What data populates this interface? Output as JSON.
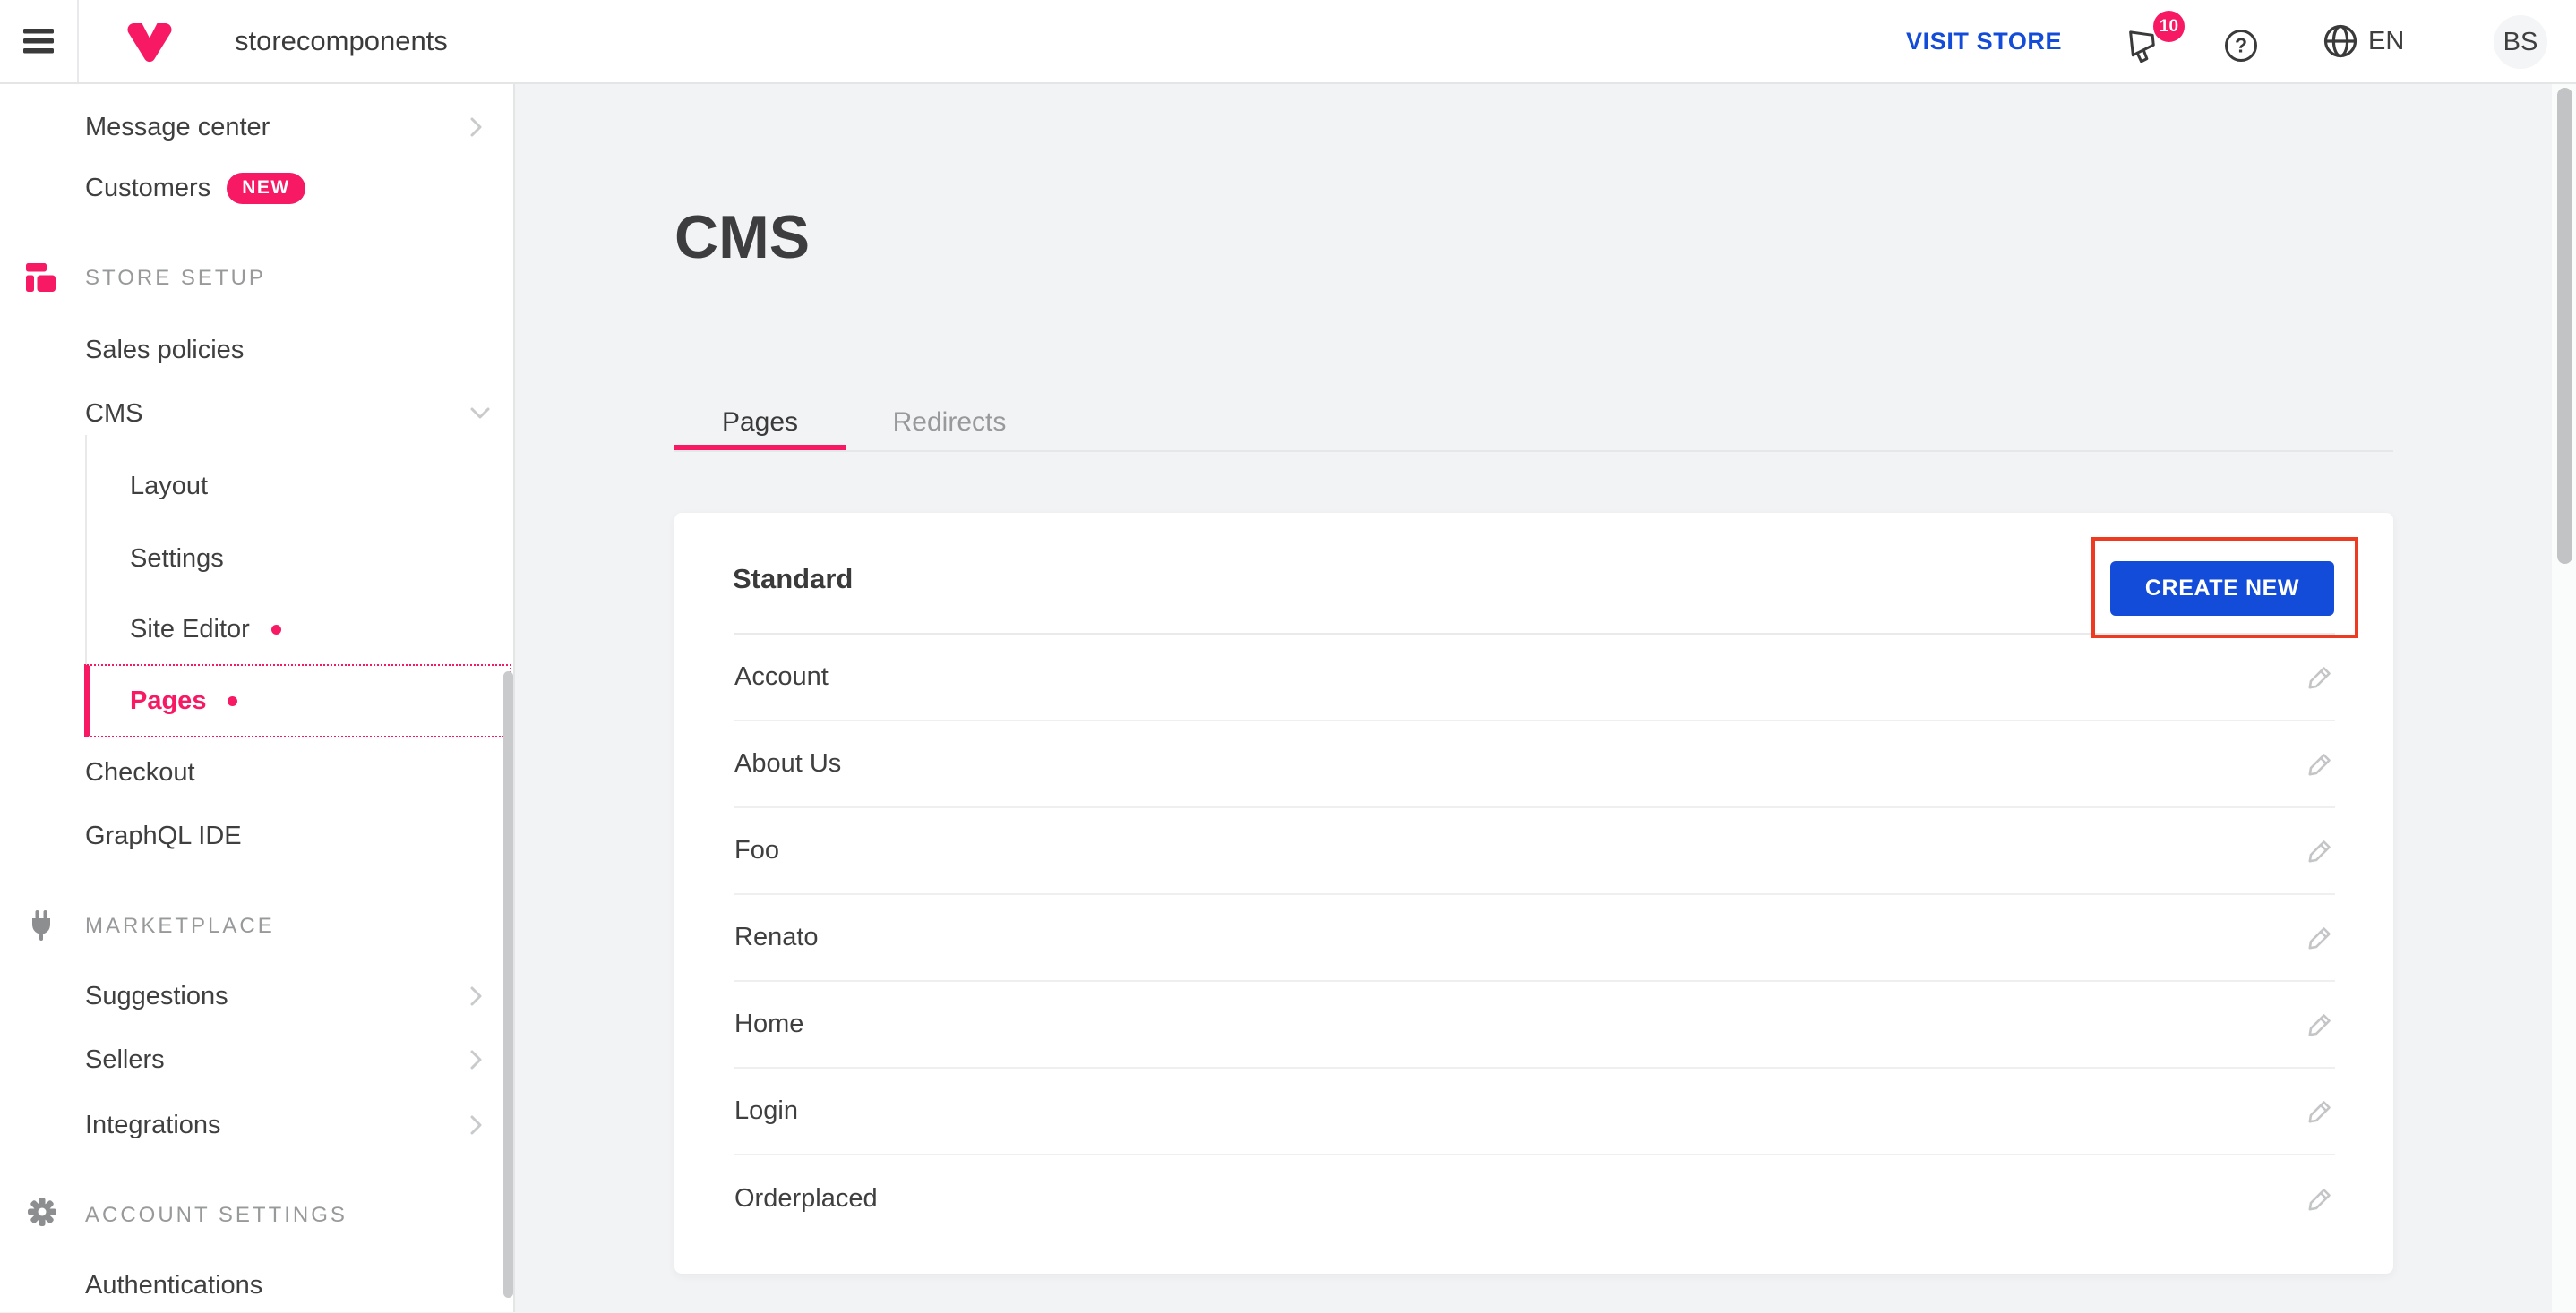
{
  "topbar": {
    "store_name": "storecomponents",
    "visit_store": "VISIT STORE",
    "notification_count": "10",
    "language": "EN",
    "user_initials": "BS"
  },
  "sidebar": {
    "message_center": "Message center",
    "customers": "Customers",
    "customers_badge": "NEW",
    "store_setup": "STORE SETUP",
    "sales_policies": "Sales policies",
    "cms": "CMS",
    "layout": "Layout",
    "settings": "Settings",
    "site_editor": "Site Editor",
    "pages": "Pages",
    "checkout": "Checkout",
    "graphql_ide": "GraphQL IDE",
    "marketplace": "MARKETPLACE",
    "suggestions": "Suggestions",
    "sellers": "Sellers",
    "integrations": "Integrations",
    "account_settings": "ACCOUNT SETTINGS",
    "authentications": "Authentications"
  },
  "main": {
    "title": "CMS",
    "tabs": [
      {
        "label": "Pages",
        "active": true
      },
      {
        "label": "Redirects",
        "active": false
      }
    ],
    "card": {
      "title": "Standard",
      "create_button": "CREATE NEW",
      "pages": [
        "Account",
        "About Us",
        "Foo",
        "Renato",
        "Home",
        "Login",
        "Orderplaced"
      ]
    }
  },
  "icons": {
    "hamburger": "menu-icon",
    "logo": "vtex-logo-icon",
    "notifications": "megaphone-icon",
    "help": "question-circle-icon",
    "language": "globe-icon",
    "store_setup": "layout-grid-icon",
    "marketplace": "plug-icon",
    "account_settings": "gear-icon",
    "row_action": "pencil-edit-icon",
    "indicator": "pink-dot"
  },
  "colors": {
    "pink_accent": "#f71963",
    "blue_action": "#134cd8",
    "annotation_red": "#ee3a21",
    "text_dark": "#3f3f40",
    "text_muted": "#97999b",
    "background": "#f2f3f5",
    "divider": "#e6e7e9"
  }
}
